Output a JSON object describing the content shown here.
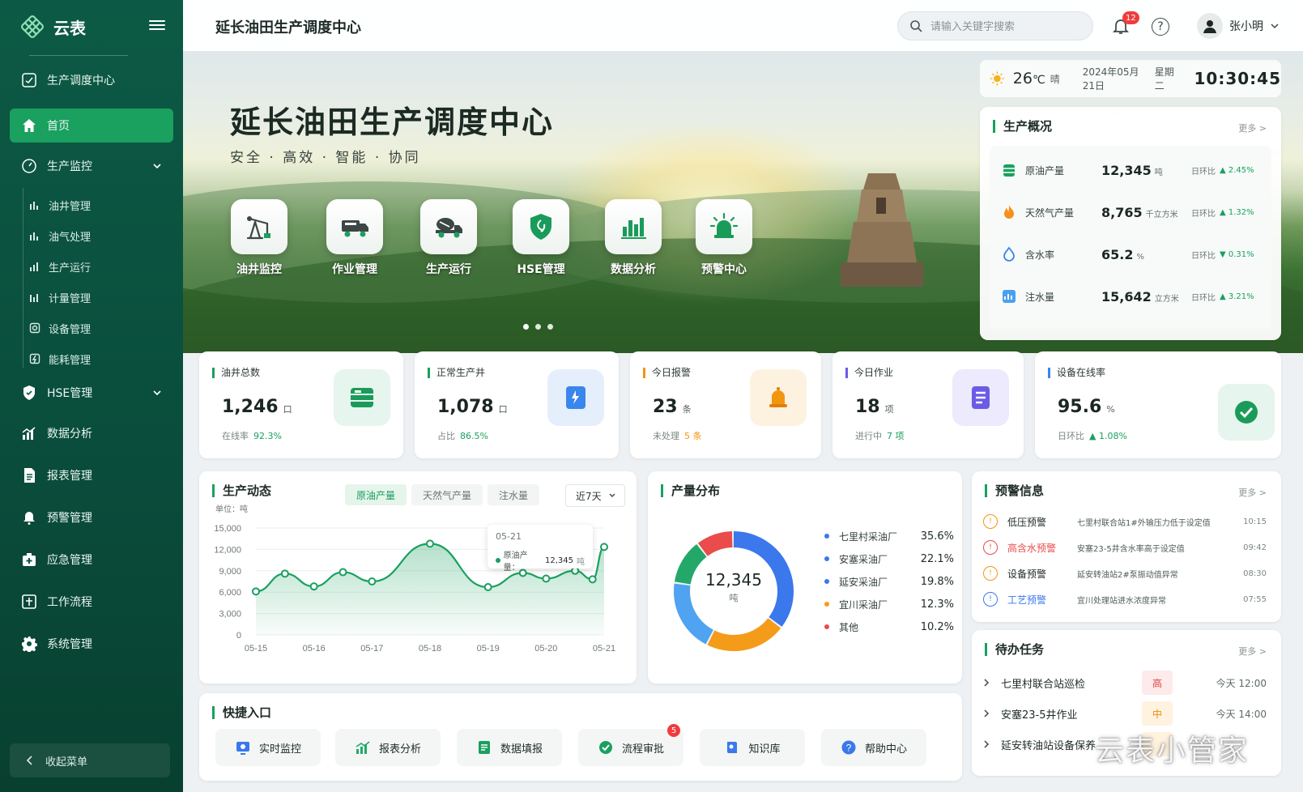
{
  "app": {
    "name": "云表"
  },
  "sidebar": {
    "section_title": "生产调度中心",
    "items": [
      {
        "label": "首页"
      },
      {
        "label": "生产监控"
      },
      {
        "label": "HSE管理"
      },
      {
        "label": "数据分析"
      },
      {
        "label": "报表管理"
      },
      {
        "label": "预警管理"
      },
      {
        "label": "应急管理"
      },
      {
        "label": "工作流程"
      },
      {
        "label": "系统管理"
      }
    ],
    "subitems": [
      {
        "label": "油井管理"
      },
      {
        "label": "油气处理"
      },
      {
        "label": "生产运行"
      },
      {
        "label": "计量管理"
      },
      {
        "label": "设备管理"
      },
      {
        "label": "能耗管理"
      }
    ],
    "collapse_label": "收起菜单"
  },
  "header": {
    "title": "延长油田生产调度中心",
    "search_placeholder": "请输入关键字搜索",
    "notification_count": "12",
    "user_name": "张小明"
  },
  "hero": {
    "title": "延长油田生产调度中心",
    "slogan": "安全 · 高效 · 智能 · 协同",
    "quick_links": [
      {
        "label": "油井监控",
        "icon": "pumpjack-icon"
      },
      {
        "label": "作业管理",
        "icon": "truck-icon"
      },
      {
        "label": "生产运行",
        "icon": "mixer-truck-icon"
      },
      {
        "label": "HSE管理",
        "icon": "shield-icon"
      },
      {
        "label": "数据分析",
        "icon": "bar-chart-icon"
      },
      {
        "label": "预警中心",
        "icon": "alarm-icon"
      }
    ]
  },
  "weather": {
    "temp": "26",
    "unit": "℃",
    "condition": "晴",
    "date": "2024年05月21日",
    "weekday": "星期二",
    "time": "10:30:45"
  },
  "overview": {
    "title": "生产概况",
    "more": "更多 >",
    "rows": [
      {
        "name": "原油产量",
        "value": "12,345",
        "unit": "吨",
        "label": "日环比",
        "change": "▲ 2.45%",
        "dir": "up"
      },
      {
        "name": "天然气产量",
        "value": "8,765",
        "unit": "千立方米",
        "label": "日环比",
        "change": "▲ 1.32%",
        "dir": "up"
      },
      {
        "name": "含水率",
        "value": "65.2",
        "unit": "%",
        "label": "日环比",
        "change": "▼ 0.31%",
        "dir": "down"
      },
      {
        "name": "注水量",
        "value": "15,642",
        "unit": "立方米",
        "label": "日环比",
        "change": "▲ 3.21%",
        "dir": "up"
      }
    ]
  },
  "stats": [
    {
      "label": "油井总数",
      "value": "1,246",
      "unit": "口",
      "foot": "在线率",
      "foot_value": "92.3%",
      "accent": "#1aa05f"
    },
    {
      "label": "正常生产井",
      "value": "1,078",
      "unit": "口",
      "foot": "占比",
      "foot_value": "86.5%",
      "accent": "#2f7fe6"
    },
    {
      "label": "今日报警",
      "value": "23",
      "unit": "条",
      "foot": "未处理",
      "foot_value": "5 条",
      "accent": "#f2950f"
    },
    {
      "label": "今日作业",
      "value": "18",
      "unit": "项",
      "foot": "进行中",
      "foot_value": "7 项",
      "accent": "#6b5be6"
    },
    {
      "label": "设备在线率",
      "value": "95.6",
      "unit": "%",
      "foot": "日环比",
      "foot_value": "▲ 1.08%",
      "accent": "#1aa05f"
    }
  ],
  "trend": {
    "title": "生产动态",
    "tabs": [
      "原油产量",
      "天然气产量",
      "注水量"
    ],
    "range": "近7天",
    "unit_label": "单位：吨",
    "tooltip": {
      "date": "05-21",
      "series": "原油产量：",
      "value": "12,345",
      "unit": "吨"
    }
  },
  "chart_data": {
    "type": "area",
    "x": [
      "05-15",
      "05-16",
      "05-17",
      "05-18",
      "05-19",
      "05-20",
      "05-21"
    ],
    "y_ticks": [
      "15,000",
      "12,000",
      "9,000",
      "6,000",
      "3,000",
      "0"
    ],
    "ylim": [
      0,
      15000
    ],
    "series": [
      {
        "name": "原油产量",
        "values": [
          6100,
          8600,
          6800,
          8800,
          7500,
          12800,
          6700,
          8700,
          7900,
          9000,
          7800,
          12345
        ]
      }
    ],
    "point_x_index": [
      0,
      0.5,
      1,
      1.5,
      2,
      3,
      4,
      4.6,
      5,
      5.5,
      5.8,
      6
    ],
    "grid": true
  },
  "distribution": {
    "title": "产量分布",
    "center_value": "12,345",
    "center_unit": "吨",
    "items": [
      {
        "name": "七里村采油厂",
        "pct": "35.6%",
        "value": 35.6,
        "color": "#3a78ec"
      },
      {
        "name": "安塞采油厂",
        "pct": "22.1%",
        "value": 22.1,
        "color": "#f59b1a"
      },
      {
        "name": "延安采油厂",
        "pct": "19.8%",
        "value": 19.8,
        "color": "#4fa3f0"
      },
      {
        "name": "宜川采油厂",
        "pct": "12.3%",
        "value": 12.3,
        "color": "#23a86a"
      },
      {
        "name": "其他",
        "pct": "10.2%",
        "value": 10.2,
        "color": "#ea4b4b"
      }
    ]
  },
  "alerts": {
    "title": "预警信息",
    "more": "更多 >",
    "items": [
      {
        "type": "低压预警",
        "desc": "七里村联合站1#外输压力低于设定值",
        "time": "10:15",
        "color": "#f2950f",
        "text_color": "#1e2a27"
      },
      {
        "type": "高含水预警",
        "desc": "安塞23-5井含水率高于设定值",
        "time": "09:42",
        "color": "#ea4b4b",
        "text_color": "#ea4b4b"
      },
      {
        "type": "设备预警",
        "desc": "延安转油站2#泵振动值异常",
        "time": "08:30",
        "color": "#f2950f",
        "text_color": "#1e2a27"
      },
      {
        "type": "工艺预警",
        "desc": "宜川处理站进水浓度异常",
        "time": "07:55",
        "color": "#3a78ec",
        "text_color": "#3a78ec"
      }
    ]
  },
  "todo": {
    "title": "待办任务",
    "more": "更多 >",
    "items": [
      {
        "title": "七里村联合站巡检",
        "priority": "高",
        "time": "今天 12:00",
        "bg": "#fdeaea",
        "fg": "#e24444"
      },
      {
        "title": "安塞23-5井作业",
        "priority": "中",
        "time": "今天 14:00",
        "bg": "#fff2df",
        "fg": "#f08c0c"
      },
      {
        "title": "延安转油站设备保养",
        "priority": "",
        "time": "",
        "bg": "#fff2df",
        "fg": "#f08c0c"
      }
    ]
  },
  "shortcuts": {
    "title": "快捷入口",
    "items": [
      {
        "label": "实时监控",
        "color": "#3a78ec"
      },
      {
        "label": "报表分析",
        "color": "#23a86a"
      },
      {
        "label": "数据填报",
        "color": "#1aa05f"
      },
      {
        "label": "流程审批",
        "color": "#1aa05f",
        "badge": "5"
      },
      {
        "label": "知识库",
        "color": "#3a78ec"
      },
      {
        "label": "帮助中心",
        "color": "#3a78ec"
      }
    ]
  },
  "watermark": "云表小管家"
}
